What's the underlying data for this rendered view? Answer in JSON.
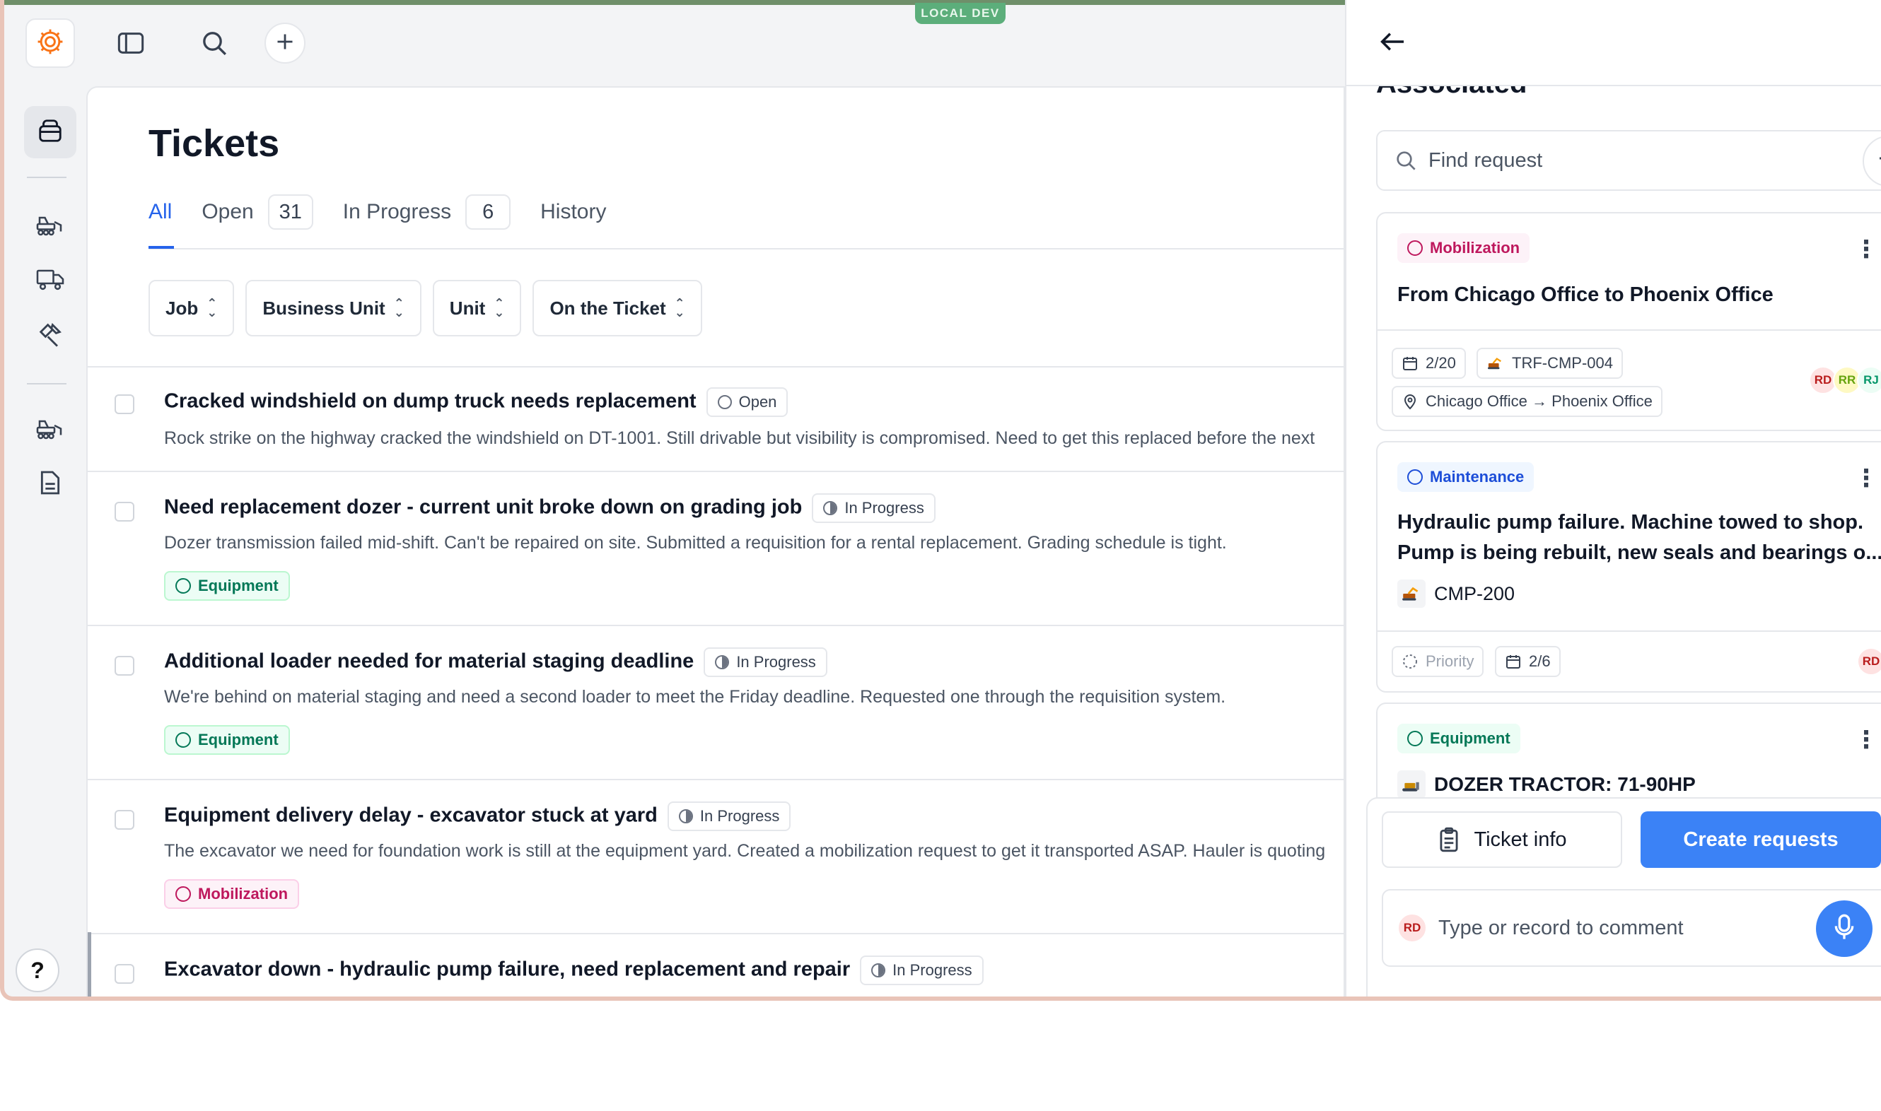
{
  "env_badge": "LOCAL DEV",
  "page": {
    "title": "Tickets",
    "tabs": [
      {
        "label": "All"
      },
      {
        "label": "Open",
        "count": "31"
      },
      {
        "label": "In Progress",
        "count": "6"
      },
      {
        "label": "History"
      }
    ],
    "filters": [
      "Job",
      "Business Unit",
      "Unit",
      "On the Ticket"
    ]
  },
  "tickets": [
    {
      "title": "Cracked windshield on dump truck needs replacement",
      "status": "Open",
      "description": "Rock strike on the highway cracked the windshield on DT-1001. Still drivable but visibility is compromised. Need to get this replaced before the next"
    },
    {
      "title": "Need replacement dozer - current unit broke down on grading job",
      "status": "In Progress",
      "description": "Dozer transmission failed mid-shift. Can't be repaired on site. Submitted a requisition for a rental replacement. Grading schedule is tight.",
      "tag": "Equipment"
    },
    {
      "title": "Additional loader needed for material staging deadline",
      "status": "In Progress",
      "description": "We're behind on material staging and need a second loader to meet the Friday deadline. Requested one through the requisition system.",
      "tag": "Equipment"
    },
    {
      "title": "Equipment delivery delay - excavator stuck at yard",
      "status": "In Progress",
      "description": "The excavator we need for foundation work is still at the equipment yard. Created a mobilization request to get it transported ASAP. Hauler is quoting",
      "tag": "Mobilization"
    },
    {
      "title": "Excavator down - hydraulic pump failure, need replacement and repair",
      "status": "In Progress"
    }
  ],
  "panel": {
    "section_heading": "Associated",
    "search_placeholder": "Find request",
    "cards": [
      {
        "tag": "Mobilization",
        "title": "From Chicago Office to Phoenix Office",
        "date": "2/20",
        "code": "TRF-CMP-004",
        "from": "Chicago Office",
        "arrow": "→",
        "to": "Phoenix Office",
        "avatars": [
          "RD",
          "RR",
          "RJ"
        ]
      },
      {
        "tag": "Maintenance",
        "title_line1": "Hydraulic pump failure. Machine towed to shop.",
        "title_line2": "Pump is being rebuilt, new seals and bearings o...",
        "machine": "CMP-200",
        "priority": "Priority",
        "date": "2/6",
        "avatars": [
          "RD"
        ]
      },
      {
        "tag": "Equipment",
        "title": "DOZER TRACTOR: 71-90HP"
      }
    ],
    "ticket_info_label": "Ticket info",
    "create_label": "Create requests",
    "comment_avatar": "RD",
    "comment_placeholder": "Type or record to comment"
  },
  "colors": {
    "accent": "#2563eb",
    "primary_button": "#3b82f6",
    "equipment": "#047857",
    "mobilization": "#be185d",
    "maintenance": "#1d4ed8"
  }
}
